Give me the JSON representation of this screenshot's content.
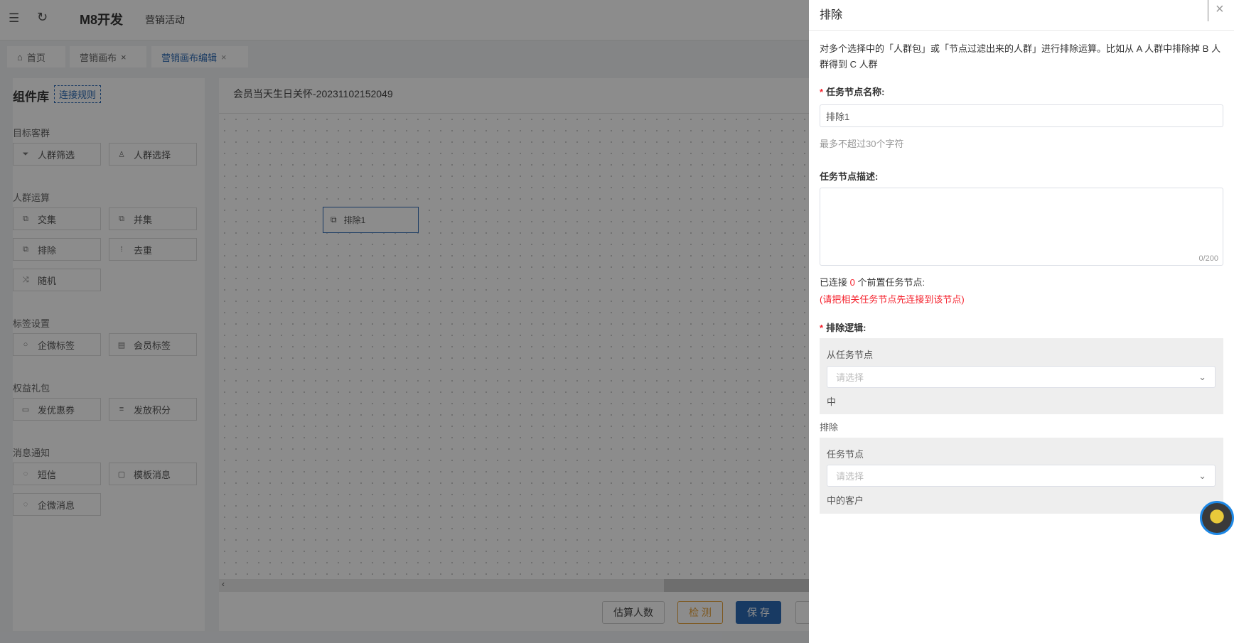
{
  "header": {
    "app_title": "M8开发",
    "module": "营销活动"
  },
  "tabs": [
    {
      "label": "首页"
    },
    {
      "label": "营销画布"
    },
    {
      "label": "营销画布编辑"
    }
  ],
  "library": {
    "title": "组件库",
    "rules_link": "连接规则",
    "sections": [
      {
        "title": "目标客群",
        "items": [
          {
            "label": "人群筛选",
            "icon": "filter-icon",
            "glyph": "⏷"
          },
          {
            "label": "人群选择",
            "icon": "user-icon",
            "glyph": "♙"
          }
        ]
      },
      {
        "title": "人群运算",
        "items": [
          {
            "label": "交集",
            "icon": "intersect-icon",
            "glyph": "⧉"
          },
          {
            "label": "并集",
            "icon": "union-icon",
            "glyph": "⧉"
          },
          {
            "label": "排除",
            "icon": "exclude-icon",
            "glyph": "⧉"
          },
          {
            "label": "去重",
            "icon": "dedupe-icon",
            "glyph": "⁞"
          },
          {
            "label": "随机",
            "icon": "shuffle-icon",
            "glyph": "⤨"
          }
        ]
      },
      {
        "title": "标签设置",
        "items": [
          {
            "label": "企微标签",
            "icon": "chat-tag-icon",
            "glyph": "○"
          },
          {
            "label": "会员标签",
            "icon": "list-icon",
            "glyph": "▤"
          }
        ]
      },
      {
        "title": "权益礼包",
        "items": [
          {
            "label": "发优惠券",
            "icon": "coupon-icon",
            "glyph": "▭"
          },
          {
            "label": "发放积分",
            "icon": "coins-icon",
            "glyph": "≡"
          }
        ]
      },
      {
        "title": "消息通知",
        "items": [
          {
            "label": "短信",
            "icon": "message-icon",
            "glyph": "◌"
          },
          {
            "label": "模板消息",
            "icon": "template-icon",
            "glyph": "▢"
          },
          {
            "label": "企微消息",
            "icon": "wechat-message-icon",
            "glyph": "◌"
          }
        ]
      }
    ]
  },
  "canvas": {
    "title": "会员当天生日关怀-20231102152049",
    "node_label": "排除1"
  },
  "footer": {
    "estimate": "估算人数",
    "check": "检 测",
    "save": "保 存"
  },
  "drawer": {
    "title": "排除",
    "description": "对多个选择中的「人群包」或「节点过滤出来的人群」进行排除运算。比如从 A 人群中排除掉 B 人群得到 C 人群",
    "name_label": "任务节点名称:",
    "name_value": "排除1",
    "name_hint": "最多不超过30个字符",
    "desc_label": "任务节点描述:",
    "desc_counter": "0/200",
    "connected_prefix": "已连接",
    "connected_count": "0",
    "connected_suffix": "个前置任务节点:",
    "connect_warning": "(请把相关任务节点先连接到该节点)",
    "logic_label": "排除逻辑:",
    "from_label": "从任务节点",
    "from_placeholder": "请选择",
    "from_suffix": "中",
    "exclude_text": "排除",
    "node_label": "任务节点",
    "node_placeholder": "请选择",
    "node_suffix": "中的客户"
  },
  "colors": {
    "primary": "#2d6bb5",
    "warning": "#e6a23c",
    "danger": "#f5222d"
  }
}
